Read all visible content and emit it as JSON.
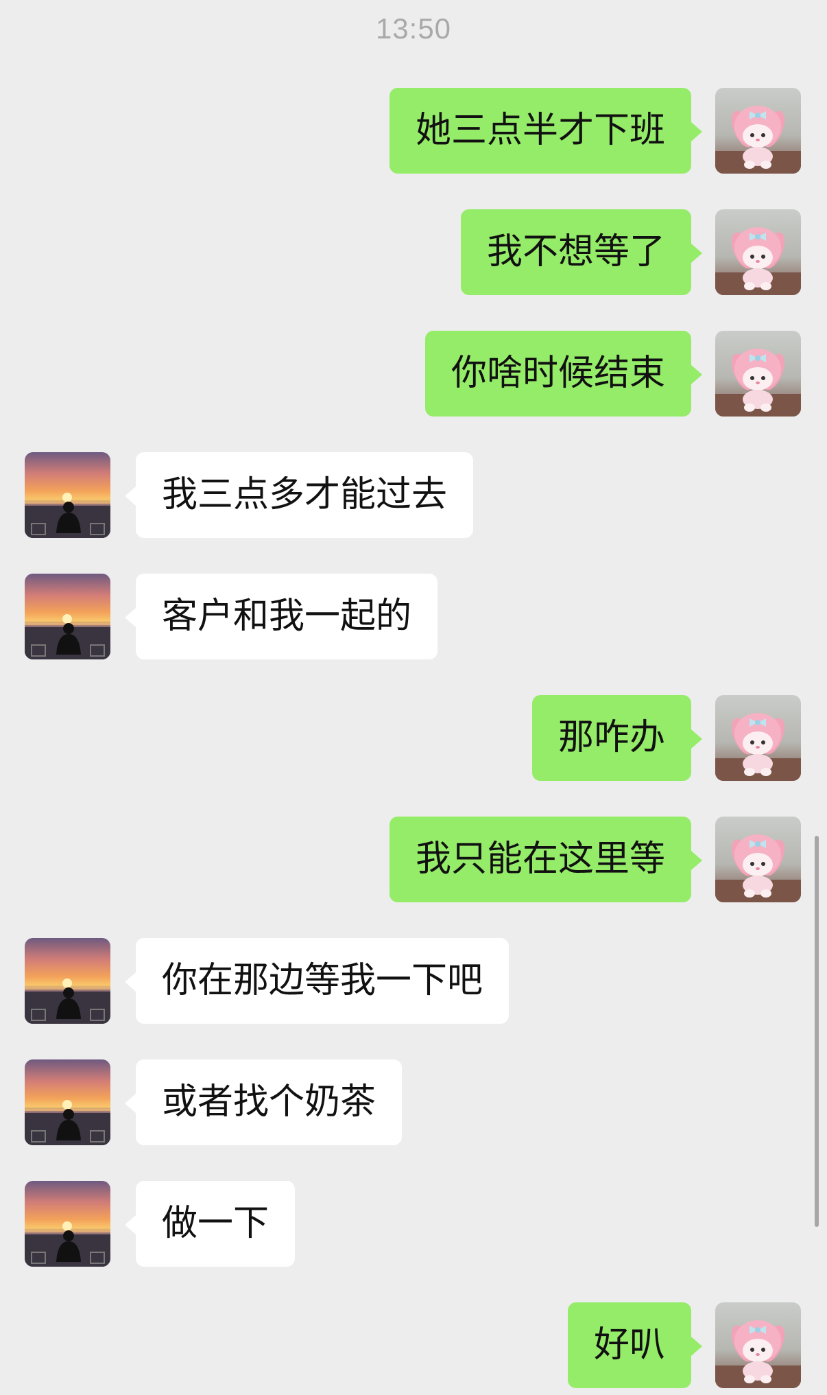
{
  "timestamp": "13:50",
  "messages": [
    {
      "side": "sent",
      "text": "她三点半才下班"
    },
    {
      "side": "sent",
      "text": "我不想等了"
    },
    {
      "side": "sent",
      "text": "你啥时候结束"
    },
    {
      "side": "recv",
      "text": "我三点多才能过去"
    },
    {
      "side": "recv",
      "text": "客户和我一起的"
    },
    {
      "side": "sent",
      "text": "那咋办"
    },
    {
      "side": "sent",
      "text": "我只能在这里等"
    },
    {
      "side": "recv",
      "text": "你在那边等我一下吧"
    },
    {
      "side": "recv",
      "text": "或者找个奶茶"
    },
    {
      "side": "recv",
      "text": "做一下"
    },
    {
      "side": "sent",
      "text": "好叭"
    }
  ],
  "avatars": {
    "self": "pink-plush-doll-avatar",
    "contact": "sunset-silhouette-avatar"
  }
}
